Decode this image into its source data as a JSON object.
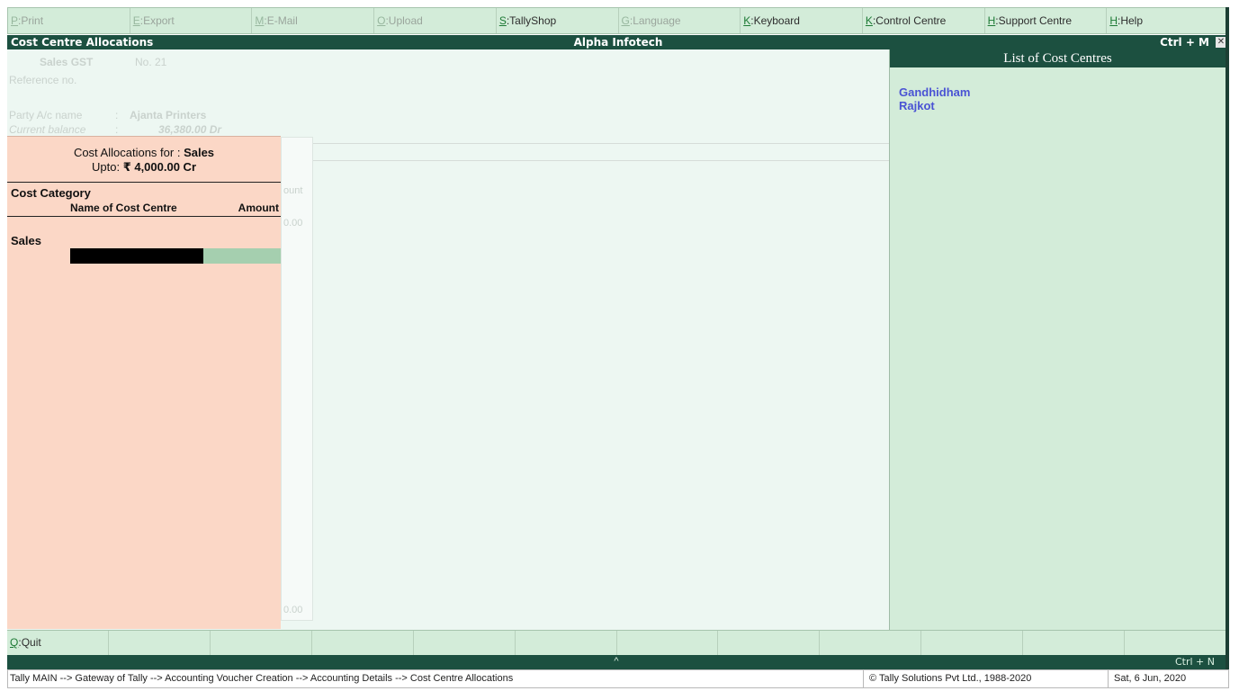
{
  "menu": [
    {
      "key": "P",
      "label": "Print",
      "enabled": false
    },
    {
      "key": "E",
      "label": "Export",
      "enabled": false
    },
    {
      "key": "M",
      "label": "E-Mail",
      "enabled": false
    },
    {
      "key": "O",
      "label": "Upload",
      "enabled": false
    },
    {
      "key": "S",
      "label": "TallyShop",
      "enabled": true
    },
    {
      "key": "G",
      "label": "Language",
      "enabled": false
    },
    {
      "key": "K",
      "label": "Keyboard",
      "enabled": true
    },
    {
      "key": "K",
      "label": "Control Centre",
      "enabled": true
    },
    {
      "key": "H",
      "label": "Support Centre",
      "enabled": true
    },
    {
      "key": "H",
      "label": "Help",
      "enabled": true
    }
  ],
  "titlebar": {
    "screen": "Cost Centre Allocations",
    "company": "Alpha Infotech",
    "shortcut": "Ctrl + M",
    "close": "✕"
  },
  "voucher": {
    "type": "Sales GST",
    "number": "No. 21",
    "reference": "Reference no.",
    "party_label": "Party A/c name",
    "party_sep": ":",
    "party_name": "Ajanta Printers",
    "balance_label": "Current balance",
    "balance_sep": ":",
    "balance_value": "36,380.00 Dr",
    "ghost_col": "ount",
    "ghost_amt1": "0.00",
    "ghost_amt2": "0.00"
  },
  "allocation": {
    "for_label": "Cost Allocations for :",
    "for_value": "Sales",
    "upto_label": "Upto:",
    "upto_value": "₹ 4,000.00 Cr",
    "col_category": "Cost Category",
    "col_name": "Name of Cost Centre",
    "col_amount": "Amount",
    "category": "Sales",
    "name_value": "",
    "amount_value": ""
  },
  "cost_centres": {
    "title": "List of Cost Centres",
    "items": [
      "Gandhidham",
      "Rajkot"
    ]
  },
  "bottom_buttons": [
    {
      "key": "Q",
      "label": "Quit"
    },
    {
      "key": "",
      "label": ""
    },
    {
      "key": "",
      "label": ""
    },
    {
      "key": "",
      "label": ""
    },
    {
      "key": "",
      "label": ""
    },
    {
      "key": "",
      "label": ""
    },
    {
      "key": "",
      "label": ""
    },
    {
      "key": "",
      "label": ""
    },
    {
      "key": "",
      "label": ""
    },
    {
      "key": "",
      "label": ""
    },
    {
      "key": "",
      "label": ""
    },
    {
      "key": "",
      "label": ""
    }
  ],
  "strip2": {
    "caret": "^",
    "shortcut": "Ctrl + N"
  },
  "status": {
    "breadcrumb": "Tally MAIN --> Gateway of Tally --> Accounting Voucher  Creation  --> Accounting Details --> Cost Centre Allocations",
    "copyright": "© Tally Solutions Pvt Ltd., 1988-2020",
    "date": "Sat, 6 Jun, 2020"
  }
}
